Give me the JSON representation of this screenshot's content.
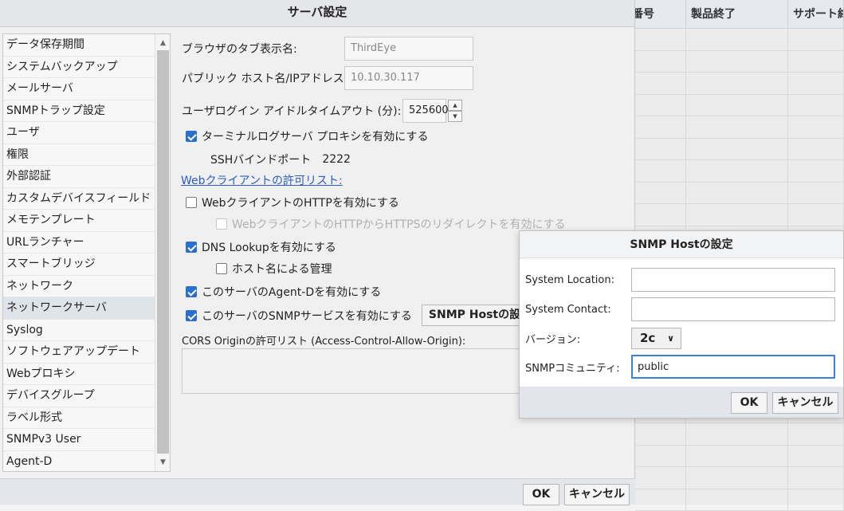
{
  "background_table": {
    "headers": [
      "番号",
      "製品終了",
      "サポート終"
    ]
  },
  "dialog": {
    "title": "サーバ設定",
    "sidebar": {
      "items": [
        {
          "label": "データ保存期間"
        },
        {
          "label": "システムバックアップ"
        },
        {
          "label": "メールサーバ"
        },
        {
          "label": "SNMPトラップ設定"
        },
        {
          "label": "ユーザ"
        },
        {
          "label": "権限"
        },
        {
          "label": "外部認証"
        },
        {
          "label": "カスタムデバイスフィールド"
        },
        {
          "label": "メモテンプレート"
        },
        {
          "label": "URLランチャー"
        },
        {
          "label": "スマートブリッジ"
        },
        {
          "label": "ネットワーク"
        },
        {
          "label": "ネットワークサーバ"
        },
        {
          "label": "Syslog"
        },
        {
          "label": "ソフトウェアアップデート"
        },
        {
          "label": "Webプロキシ"
        },
        {
          "label": "デバイスグループ"
        },
        {
          "label": "ラベル形式"
        },
        {
          "label": "SNMPv3 User"
        },
        {
          "label": "Agent-D"
        }
      ],
      "selected": "ネットワークサーバ"
    },
    "form": {
      "tab_name_label": "ブラウザのタブ表示名:",
      "tab_name_value": "ThirdEye",
      "public_host_label": "パブリック ホスト名/IPアドレス:",
      "public_host_value": "10.10.30.117",
      "idle_timeout_label": "ユーザログイン アイドルタイムアウト (分):",
      "idle_timeout_value": "525600",
      "terminal_proxy_label": "ターミナルログサーバ プロキシを有効にする",
      "ssh_port_label": "SSHバインドポート",
      "ssh_port_value": "2222",
      "web_allow_list_link": "Webクライアントの許可リスト:",
      "web_http_label": "WebクライアントのHTTPを有効にする",
      "web_redirect_label": "WebクライアントのHTTPからHTTPSのリダイレクトを有効にする",
      "dns_lookup_label": "DNS Lookupを有効にする",
      "hostname_mgmt_label": "ホスト名による管理",
      "agent_d_label": "このサーバのAgent-Dを有効にする",
      "snmp_service_label": "このサーバのSNMPサービスを有効にする",
      "snmp_host_button": "SNMP Hostの設定",
      "cors_label": "CORS Originの許可リスト (Access-Control-Allow-Origin):"
    },
    "ok_label": "OK",
    "cancel_label": "キャンセル"
  },
  "snmp_popup": {
    "title": "SNMP Hostの設定",
    "location_label": "System Location:",
    "location_value": "",
    "contact_label": "System Contact:",
    "contact_value": "",
    "version_label": "バージョン:",
    "version_value": "2c",
    "community_label": "SNMPコミュニティ:",
    "community_value": "public",
    "ok_label": "OK",
    "cancel_label": "キャンセル"
  }
}
